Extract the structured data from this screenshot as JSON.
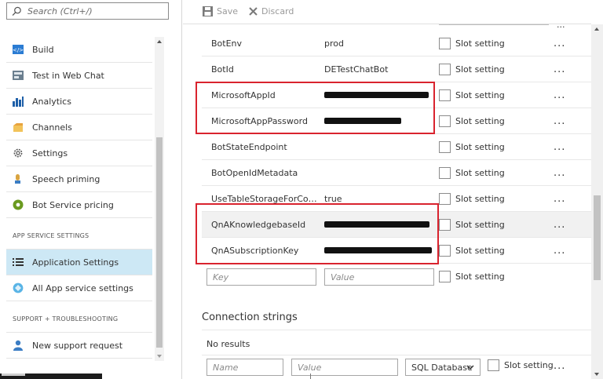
{
  "search": {
    "placeholder": "Search (Ctrl+/)"
  },
  "menu": {
    "items": [
      {
        "label": "Build",
        "icon": "code-icon"
      },
      {
        "label": "Test in Web Chat",
        "icon": "chat-test-icon"
      },
      {
        "label": "Analytics",
        "icon": "analytics-icon"
      },
      {
        "label": "Channels",
        "icon": "channels-icon"
      },
      {
        "label": "Settings",
        "icon": "gear-icon"
      },
      {
        "label": "Speech priming",
        "icon": "speech-icon"
      },
      {
        "label": "Bot Service pricing",
        "icon": "pricing-icon"
      }
    ],
    "section_app": "APP SERVICE SETTINGS",
    "app_items": [
      {
        "label": "Application Settings",
        "icon": "list-icon",
        "active": true
      },
      {
        "label": "All App service settings",
        "icon": "app-service-icon"
      }
    ],
    "section_support": "SUPPORT + TROUBLESHOOTING",
    "support_items": [
      {
        "label": "New support request",
        "icon": "support-icon"
      }
    ]
  },
  "toolbar": {
    "save_label": "Save",
    "discard_label": "Discard"
  },
  "app_settings": {
    "slot_label": "Slot setting",
    "more_label": "...",
    "rows": [
      {
        "name": "BotEnv",
        "value": "prod"
      },
      {
        "name": "BotId",
        "value": "DETestChatBot"
      },
      {
        "name": "MicrosoftAppId",
        "value": ""
      },
      {
        "name": "MicrosoftAppPassword",
        "value": ""
      },
      {
        "name": "BotStateEndpoint",
        "value": ""
      },
      {
        "name": "BotOpenIdMetadata",
        "value": ""
      },
      {
        "name": "UseTableStorageForConve...",
        "value": "true"
      },
      {
        "name": "QnAKnowledgebaseId",
        "value": ""
      },
      {
        "name": "QnASubscriptionKey",
        "value": ""
      }
    ],
    "new_key_placeholder": "Key",
    "new_value_placeholder": "Value"
  },
  "connection_strings": {
    "title": "Connection strings",
    "no_results": "No results",
    "name_placeholder": "Name",
    "value_placeholder": "Value",
    "type_selected": "SQL Database",
    "slot_label": "Slot setting",
    "more_label": "..."
  },
  "colors": {
    "accent_active": "#cde8f5",
    "highlight_box": "#d9232e"
  }
}
